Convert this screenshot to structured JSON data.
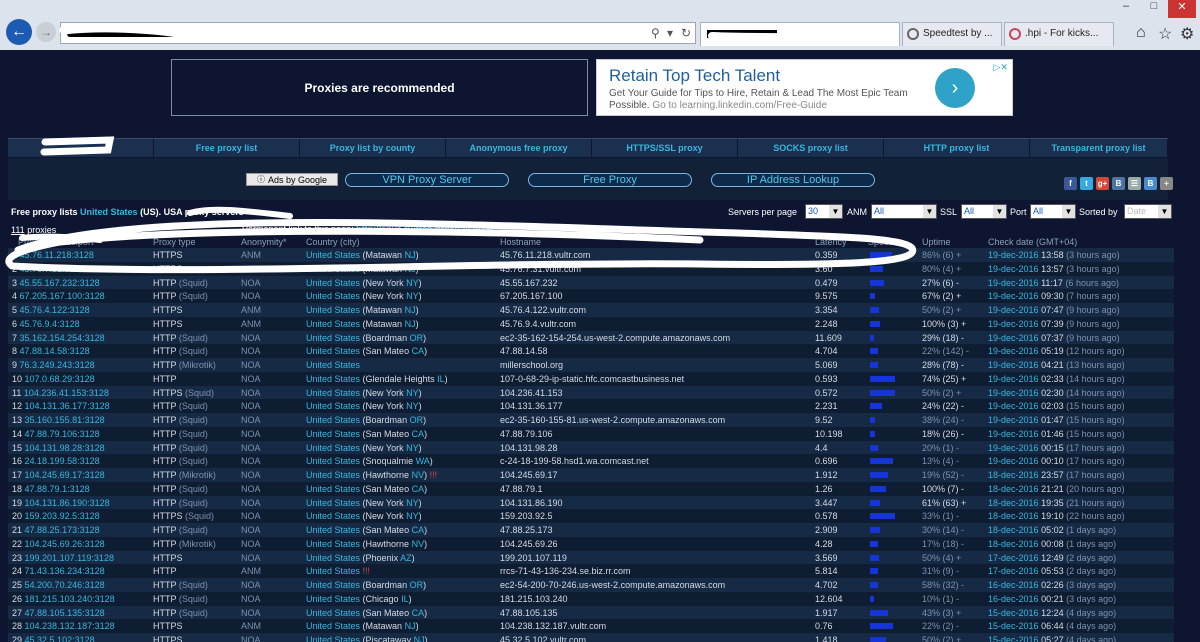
{
  "browser": {
    "tabs": [
      {
        "label": ""
      },
      {
        "label": "Speedtest by ..."
      },
      {
        "label": ".hpi - For kicks..."
      }
    ]
  },
  "banner": {
    "left_text": "Proxies are recommended",
    "ad_title": "Retain Top Tech Talent",
    "ad_body": "Get Your Guide for Tips to Hire, Retain & Lead The Most Epic Team Possible.",
    "ad_link": "Go to learning.linkedin.com/Free-Guide"
  },
  "nav": [
    "",
    "Free proxy list",
    "Proxy list by county",
    "Anonymous free proxy",
    "HTTPS/SSL proxy",
    "SOCKS proxy list",
    "HTTP proxy list",
    "Transparent proxy list"
  ],
  "buttons": {
    "ads_by_google": "Ads by Google",
    "vpn": "VPN Proxy Server",
    "free_proxy": "Free Proxy",
    "ip_lookup": "IP Address Lookup"
  },
  "filters": {
    "title_prefix": "Free proxy lists",
    "title_country": "United States",
    "title_suffix": "(US). USA proxy servers",
    "servers_per_page_label": "Servers per page",
    "servers_per_page": "30",
    "anm_label": "ANM",
    "anm": "All",
    "ssl_label": "SSL",
    "ssl": "All",
    "port_label": "Port",
    "port": "All",
    "sorted_label": "Sorted by",
    "sorted": "Date"
  },
  "count": {
    "number": "111",
    "label": "proxies"
  },
  "permalink": {
    "label": "Permanent link to this page:",
    "url": "http://spys.ru/free-proxy-list/US/"
  },
  "headers": [
    "Proxy address:port",
    "Proxy type",
    "Anonymity*",
    "Country (city)",
    "Hostname",
    "Latency",
    "Speed",
    "Uptime",
    "Check date (GMT+04)"
  ],
  "rows": [
    {
      "n": "1",
      "ip": "45.76.11.218:3128",
      "type": "HTTPS",
      "sub": "",
      "anm": "ANM",
      "country": "United States",
      "city": "(Matawan",
      "state": "NJ",
      "bang": "",
      "host": "45.76.11.218.vultr.com",
      "lat": "0.359",
      "speed": 0.85,
      "up": "86% (6) +",
      "updim": true,
      "date": "19-dec-2016",
      "time": "13:58",
      "ago": "(3 hours ago)"
    },
    {
      "n": "2",
      "ip": "45.76.7.31:3128",
      "type": "HTTPS",
      "sub": "",
      "anm": "ANM",
      "country": "United States",
      "city": "(Matawan",
      "state": "NJ",
      "bang": "",
      "host": "45.76.7.31.vultr.com",
      "lat": "3.60",
      "speed": 0.5,
      "up": "80% (4) +",
      "updim": true,
      "date": "19-dec-2016",
      "time": "13:57",
      "ago": "(3 hours ago)"
    },
    {
      "n": "3",
      "ip": "45.55.167.232:3128",
      "type": "HTTP",
      "sub": "(Squid)",
      "anm": "NOA",
      "country": "United States",
      "city": "(New York",
      "state": "NY",
      "bang": "",
      "host": "45.55.167.232",
      "lat": "0.479",
      "speed": 0.55,
      "up": "27% (6) -",
      "updim": false,
      "date": "19-dec-2016",
      "time": "11:17",
      "ago": "(6 hours ago)"
    },
    {
      "n": "4",
      "ip": "67.205.167.100:3128",
      "type": "HTTP",
      "sub": "(Squid)",
      "anm": "NOA",
      "country": "United States",
      "city": "(New York",
      "state": "NY",
      "bang": "",
      "host": "67.205.167.100",
      "lat": "9.575",
      "speed": 0.2,
      "up": "67% (2) +",
      "updim": false,
      "date": "19-dec-2016",
      "time": "09:30",
      "ago": "(7 hours ago)"
    },
    {
      "n": "5",
      "ip": "45.76.4.122:3128",
      "type": "HTTPS",
      "sub": "",
      "anm": "ANM",
      "country": "United States",
      "city": "(Matawan",
      "state": "NJ",
      "bang": "",
      "host": "45.76.4.122.vultr.com",
      "lat": "3.354",
      "speed": 0.35,
      "up": "50% (2) +",
      "updim": true,
      "date": "19-dec-2016",
      "time": "07:47",
      "ago": "(9 hours ago)"
    },
    {
      "n": "6",
      "ip": "45.76.9.4:3128",
      "type": "HTTPS",
      "sub": "",
      "anm": "ANM",
      "country": "United States",
      "city": "(Matawan",
      "state": "NJ",
      "bang": "",
      "host": "45.76.9.4.vultr.com",
      "lat": "2.248",
      "speed": 0.4,
      "up": "100% (3) +",
      "updim": false,
      "date": "19-dec-2016",
      "time": "07:39",
      "ago": "(9 hours ago)"
    },
    {
      "n": "7",
      "ip": "35.162.154.254:3128",
      "type": "HTTP",
      "sub": "(Squid)",
      "anm": "NOA",
      "country": "United States",
      "city": "(Boardman",
      "state": "OR",
      "bang": "",
      "host": "ec2-35-162-154-254.us-west-2.compute.amazonaws.com",
      "lat": "11.609",
      "speed": 0.15,
      "up": "29% (18) -",
      "updim": false,
      "date": "19-dec-2016",
      "time": "07:37",
      "ago": "(9 hours ago)"
    },
    {
      "n": "8",
      "ip": "47.88.14.58:3128",
      "type": "HTTP",
      "sub": "(Squid)",
      "anm": "NOA",
      "country": "United States",
      "city": "(San Mateo",
      "state": "CA",
      "bang": "",
      "host": "47.88.14.58",
      "lat": "4.704",
      "speed": 0.3,
      "up": "22% (142) -",
      "updim": true,
      "date": "19-dec-2016",
      "time": "05:19",
      "ago": "(12 hours ago)"
    },
    {
      "n": "9",
      "ip": "76.3.249.243:3128",
      "type": "HTTP",
      "sub": "(Mikrotik)",
      "anm": "NOA",
      "country": "United States",
      "city": "",
      "state": "",
      "bang": "",
      "host": "millerschool.org",
      "lat": "5.069",
      "speed": 0.3,
      "up": "28% (78) -",
      "updim": false,
      "date": "19-dec-2016",
      "time": "04:21",
      "ago": "(13 hours ago)"
    },
    {
      "n": "10",
      "ip": "107.0.68.29:3128",
      "type": "HTTP",
      "sub": "",
      "anm": "NOA",
      "country": "United States",
      "city": "(Glendale Heights",
      "state": "IL",
      "bang": "",
      "host": "107-0-68-29-ip-static.hfc.comcastbusiness.net",
      "lat": "0.593",
      "speed": 0.95,
      "up": "74% (25) +",
      "updim": false,
      "date": "19-dec-2016",
      "time": "02:33",
      "ago": "(14 hours ago)"
    },
    {
      "n": "11",
      "ip": "104.236.41.153:3128",
      "type": "HTTPS",
      "sub": "(Squid)",
      "anm": "NOA",
      "country": "United States",
      "city": "(New York",
      "state": "NY",
      "bang": "",
      "host": "104.236.41.153",
      "lat": "0.572",
      "speed": 0.95,
      "up": "50% (2) +",
      "updim": true,
      "date": "19-dec-2016",
      "time": "02:30",
      "ago": "(14 hours ago)"
    },
    {
      "n": "12",
      "ip": "104.131.36.177:3128",
      "type": "HTTP",
      "sub": "(Squid)",
      "anm": "NOA",
      "country": "United States",
      "city": "(New York",
      "state": "NY",
      "bang": "",
      "host": "104.131.36.177",
      "lat": "2.231",
      "speed": 0.45,
      "up": "24% (22) -",
      "updim": false,
      "date": "19-dec-2016",
      "time": "02:03",
      "ago": "(15 hours ago)"
    },
    {
      "n": "13",
      "ip": "35.160.155.81:3128",
      "type": "HTTP",
      "sub": "(Squid)",
      "anm": "NOA",
      "country": "United States",
      "city": "(Boardman",
      "state": "OR",
      "bang": "",
      "host": "ec2-35-160-155-81.us-west-2.compute.amazonaws.com",
      "lat": "9.52",
      "speed": 0.2,
      "up": "38% (24) -",
      "updim": true,
      "date": "19-dec-2016",
      "time": "01:47",
      "ago": "(15 hours ago)"
    },
    {
      "n": "14",
      "ip": "47.88.79.106:3128",
      "type": "HTTP",
      "sub": "(Squid)",
      "anm": "NOA",
      "country": "United States",
      "city": "(San Mateo",
      "state": "CA",
      "bang": "",
      "host": "47.88.79.106",
      "lat": "10.198",
      "speed": 0.2,
      "up": "18% (26) -",
      "updim": false,
      "date": "19-dec-2016",
      "time": "01:46",
      "ago": "(15 hours ago)"
    },
    {
      "n": "15",
      "ip": "104.131.98.28:3128",
      "type": "HTTP",
      "sub": "(Squid)",
      "anm": "NOA",
      "country": "United States",
      "city": "(New York",
      "state": "NY",
      "bang": "",
      "host": "104.131.98.28",
      "lat": "4.4",
      "speed": 0.3,
      "up": "20% (1) -",
      "updim": true,
      "date": "19-dec-2016",
      "time": "00:15",
      "ago": "(17 hours ago)"
    },
    {
      "n": "16",
      "ip": "24.18.199.58:3128",
      "type": "HTTP",
      "sub": "(Squid)",
      "anm": "NOA",
      "country": "United States",
      "city": "(Snoqualmie",
      "state": "WA",
      "bang": "",
      "host": "c-24-18-199-58.hsd1.wa.comcast.net",
      "lat": "0.696",
      "speed": 0.9,
      "up": "13% (4) -",
      "updim": true,
      "date": "19-dec-2016",
      "time": "00:10",
      "ago": "(17 hours ago)"
    },
    {
      "n": "17",
      "ip": "104.245.69.17:3128",
      "type": "HTTP",
      "sub": "(Mikrotik)",
      "anm": "NOA",
      "country": "United States",
      "city": "(Hawthorne",
      "state": "NV",
      "bang": "!!!",
      "host": "104.245.69.17",
      "lat": "1.912",
      "speed": 0.7,
      "up": "19% (52) -",
      "updim": true,
      "date": "18-dec-2016",
      "time": "23:57",
      "ago": "(17 hours ago)"
    },
    {
      "n": "18",
      "ip": "47.88.79.1:3128",
      "type": "HTTP",
      "sub": "(Squid)",
      "anm": "NOA",
      "country": "United States",
      "city": "(San Mateo",
      "state": "CA",
      "bang": "",
      "host": "47.88.79.1",
      "lat": "1.26",
      "speed": 0.6,
      "up": "100% (7) -",
      "updim": false,
      "date": "18-dec-2016",
      "time": "21:21",
      "ago": "(20 hours ago)"
    },
    {
      "n": "19",
      "ip": "104.131.86.190:3128",
      "type": "HTTP",
      "sub": "(Squid)",
      "anm": "NOA",
      "country": "United States",
      "city": "(New York",
      "state": "NY",
      "bang": "",
      "host": "104.131.86.190",
      "lat": "3.447",
      "speed": 0.4,
      "up": "61% (63) +",
      "updim": false,
      "date": "18-dec-2016",
      "time": "19:35",
      "ago": "(21 hours ago)"
    },
    {
      "n": "20",
      "ip": "159.203.92.5:3128",
      "type": "HTTPS",
      "sub": "(Squid)",
      "anm": "NOA",
      "country": "United States",
      "city": "(New York",
      "state": "NY",
      "bang": "",
      "host": "159.203.92.5",
      "lat": "0.578",
      "speed": 0.95,
      "up": "33% (1) -",
      "updim": true,
      "date": "18-dec-2016",
      "time": "19:10",
      "ago": "(22 hours ago)"
    },
    {
      "n": "21",
      "ip": "47.88.25.173:3128",
      "type": "HTTP",
      "sub": "(Squid)",
      "anm": "NOA",
      "country": "United States",
      "city": "(San Mateo",
      "state": "CA",
      "bang": "",
      "host": "47.88.25.173",
      "lat": "2.909",
      "speed": 0.4,
      "up": "30% (14) -",
      "updim": true,
      "date": "18-dec-2016",
      "time": "05:02",
      "ago": "(1 days ago)"
    },
    {
      "n": "22",
      "ip": "104.245.69.26:3128",
      "type": "HTTP",
      "sub": "(Mikrotik)",
      "anm": "NOA",
      "country": "United States",
      "city": "(Hawthorne",
      "state": "NV",
      "bang": "",
      "host": "104.245.69.26",
      "lat": "4.28",
      "speed": 0.3,
      "up": "17% (18) -",
      "updim": true,
      "date": "18-dec-2016",
      "time": "00:08",
      "ago": "(1 days ago)"
    },
    {
      "n": "23",
      "ip": "199.201.107.119:3128",
      "type": "HTTPS",
      "sub": "",
      "anm": "NOA",
      "country": "United States",
      "city": "(Phoenix",
      "state": "AZ",
      "bang": "",
      "host": "199.201.107.119",
      "lat": "3.569",
      "speed": 0.35,
      "up": "50% (4) +",
      "updim": true,
      "date": "17-dec-2016",
      "time": "12:49",
      "ago": "(2 days ago)"
    },
    {
      "n": "24",
      "ip": "71.43.136.234:3128",
      "type": "HTTP",
      "sub": "",
      "anm": "ANM",
      "country": "United States",
      "city": "",
      "state": "",
      "bang": "!!!",
      "host": "rrcs-71-43-136-234.se.biz.rr.com",
      "lat": "5.814",
      "speed": 0.3,
      "up": "31% (9) -",
      "updim": true,
      "date": "17-dec-2016",
      "time": "05:53",
      "ago": "(2 days ago)"
    },
    {
      "n": "25",
      "ip": "54.200.70.246:3128",
      "type": "HTTP",
      "sub": "(Squid)",
      "anm": "NOA",
      "country": "United States",
      "city": "(Boardman",
      "state": "OR",
      "bang": "",
      "host": "ec2-54-200-70-246.us-west-2.compute.amazonaws.com",
      "lat": "4.702",
      "speed": 0.3,
      "up": "58% (32) -",
      "updim": true,
      "date": "16-dec-2016",
      "time": "02:26",
      "ago": "(3 days ago)"
    },
    {
      "n": "26",
      "ip": "181.215.103.240:3128",
      "type": "HTTP",
      "sub": "(Squid)",
      "anm": "NOA",
      "country": "United States",
      "city": "(Chicago",
      "state": "IL",
      "bang": "",
      "host": "181.215.103.240",
      "lat": "12.604",
      "speed": 0.15,
      "up": "10% (1) -",
      "updim": true,
      "date": "16-dec-2016",
      "time": "00:21",
      "ago": "(3 days ago)"
    },
    {
      "n": "27",
      "ip": "47.88.105.135:3128",
      "type": "HTTP",
      "sub": "(Squid)",
      "anm": "NOA",
      "country": "United States",
      "city": "(San Mateo",
      "state": "CA",
      "bang": "",
      "host": "47.88.105.135",
      "lat": "1.917",
      "speed": 0.7,
      "up": "43% (3) +",
      "updim": true,
      "date": "15-dec-2016",
      "time": "12:24",
      "ago": "(4 days ago)"
    },
    {
      "n": "28",
      "ip": "104.238.132.187:3128",
      "type": "HTTPS",
      "sub": "",
      "anm": "ANM",
      "country": "United States",
      "city": "(Matawan",
      "state": "NJ",
      "bang": "",
      "host": "104.238.132.187.vultr.com",
      "lat": "0.76",
      "speed": 0.9,
      "up": "22% (2) -",
      "updim": true,
      "date": "15-dec-2016",
      "time": "06:44",
      "ago": "(4 days ago)"
    },
    {
      "n": "29",
      "ip": "45.32.5.102:3128",
      "type": "HTTPS",
      "sub": "",
      "anm": "NOA",
      "country": "United States",
      "city": "(Piscataway",
      "state": "NJ",
      "bang": "",
      "host": "45.32.5.102.vultr.com",
      "lat": "1.418",
      "speed": 0.6,
      "up": "50% (2) +",
      "updim": true,
      "date": "15-dec-2016",
      "time": "05:27",
      "ago": "(4 days ago)"
    }
  ]
}
